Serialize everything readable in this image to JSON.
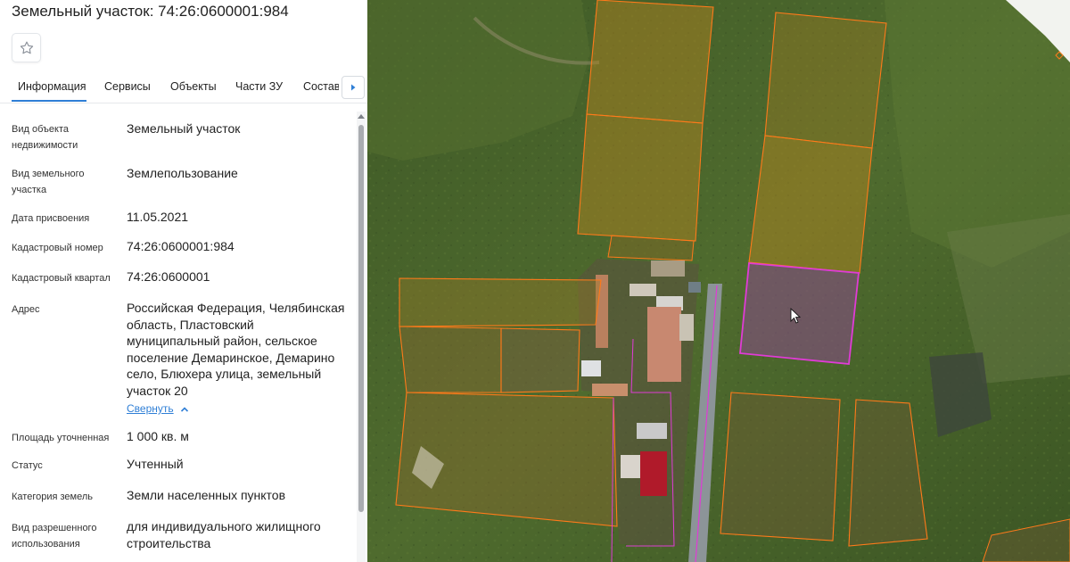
{
  "title": "Земельный участок: 74:26:0600001:984",
  "favorite_icon": "star-icon",
  "tabs": [
    {
      "label": "Информация",
      "active": true
    },
    {
      "label": "Сервисы",
      "active": false
    },
    {
      "label": "Объекты",
      "active": false
    },
    {
      "label": "Части ЗУ",
      "active": false
    },
    {
      "label": "Состав",
      "active": false
    }
  ],
  "tab_scroll_icon": "chevron-right-icon",
  "info": {
    "object_type": {
      "label": "Вид объекта недвижимости",
      "value": "Земельный участок"
    },
    "land_type": {
      "label": "Вид земельного участка",
      "value": "Землепользование"
    },
    "date_assigned": {
      "label": "Дата присвоения",
      "value": "11.05.2021"
    },
    "cadastral_number": {
      "label": "Кадастровый номер",
      "value": "74:26:0600001:984"
    },
    "cadastral_quarter": {
      "label": "Кадастровый квартал",
      "value": "74:26:0600001"
    },
    "address": {
      "label": "Адрес",
      "value": "Российская Федерация, Челябинская область, Пластовский муниципальный район, сельское поселение Демаринское, Демарино село, Блюхера улица, земельный участок 20",
      "collapse_link": "Свернуть"
    },
    "area": {
      "label": "Площадь уточненная",
      "value": "1 000 кв. м"
    },
    "status": {
      "label": "Статус",
      "value": "Учтенный"
    },
    "land_category": {
      "label": "Категория земель",
      "value": "Земли населенных пунктов"
    },
    "permitted_use": {
      "label": "Вид разрешенного использования",
      "value": "для индивидуального жилищного строительства"
    }
  },
  "map": {
    "parcel_outline_color": "#ff7a1a",
    "selected_parcel_color": "#e03bd6",
    "cursor_icon": "mouse-pointer-icon"
  }
}
